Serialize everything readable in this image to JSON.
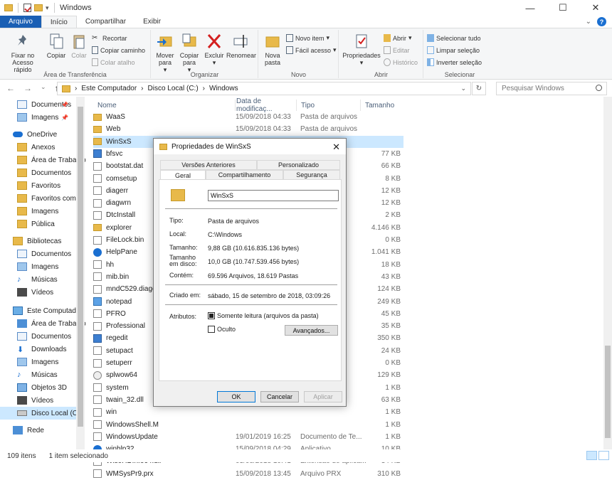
{
  "window": {
    "title": "Windows"
  },
  "tabs": {
    "file": "Arquivo",
    "home": "Início",
    "share": "Compartilhar",
    "view": "Exibir"
  },
  "ribbon": {
    "pin": "Fixar no Acesso rápido",
    "copy": "Copiar",
    "paste": "Colar",
    "cut": "Recortar",
    "copy_path": "Copiar caminho",
    "paste_shortcut": "Colar atalho",
    "group_clipboard": "Área de Transferência",
    "move_to": "Mover para",
    "copy_to": "Copiar para",
    "delete": "Excluir",
    "rename": "Renomear",
    "group_organize": "Organizar",
    "new_folder": "Nova pasta",
    "new_item": "Novo item",
    "easy_access": "Fácil acesso",
    "group_new": "Novo",
    "properties": "Propriedades",
    "open": "Abrir",
    "edit": "Editar",
    "history": "Histórico",
    "group_open": "Abrir",
    "select_all": "Selecionar tudo",
    "clear_selection": "Limpar seleção",
    "invert_selection": "Inverter seleção",
    "group_select": "Selecionar"
  },
  "address": {
    "crumbs": [
      "Este Computador",
      "Disco Local (C:)",
      "Windows"
    ],
    "search_placeholder": "Pesquisar Windows"
  },
  "navpane": [
    {
      "label": "Documentos",
      "pinned": true
    },
    {
      "label": "Imagens",
      "pinned": true
    },
    {
      "label": "OneDrive"
    },
    {
      "label": "Anexos"
    },
    {
      "label": "Área de Trabalho"
    },
    {
      "label": "Documentos"
    },
    {
      "label": "Favoritos"
    },
    {
      "label": "Favoritos compa"
    },
    {
      "label": "Imagens"
    },
    {
      "label": "Pública"
    },
    {
      "label": "Bibliotecas"
    },
    {
      "label": "Documentos"
    },
    {
      "label": "Imagens"
    },
    {
      "label": "Músicas"
    },
    {
      "label": "Vídeos"
    },
    {
      "label": "Este Computador"
    },
    {
      "label": "Área de Trabalho"
    },
    {
      "label": "Documentos"
    },
    {
      "label": "Downloads"
    },
    {
      "label": "Imagens"
    },
    {
      "label": "Músicas"
    },
    {
      "label": "Objetos 3D"
    },
    {
      "label": "Vídeos"
    },
    {
      "label": "Disco Local (C:)"
    },
    {
      "label": "Rede"
    }
  ],
  "columns": {
    "name": "Nome",
    "date": "Data de modificaç...",
    "type": "Tipo",
    "size": "Tamanho"
  },
  "files": [
    {
      "name": "WaaS",
      "date": "15/09/2018 04:33",
      "type": "Pasta de arquivos",
      "size": "",
      "icon": "folder"
    },
    {
      "name": "Web",
      "date": "15/09/2018 04:33",
      "type": "Pasta de arquivos",
      "size": "",
      "icon": "folder"
    },
    {
      "name": "WinSxS",
      "date": "",
      "type": "",
      "size": "",
      "icon": "folder"
    },
    {
      "name": "bfsvc",
      "date": "",
      "type": "",
      "size": "77 KB",
      "icon": "app"
    },
    {
      "name": "bootstat.dat",
      "date": "",
      "type": "",
      "size": "66 KB",
      "icon": "file"
    },
    {
      "name": "comsetup",
      "date": "",
      "type": "",
      "size": "8 KB",
      "icon": "file"
    },
    {
      "name": "diagerr",
      "date": "",
      "type": "",
      "size": "12 KB",
      "icon": "file"
    },
    {
      "name": "diagwrn",
      "date": "",
      "type": "",
      "size": "12 KB",
      "icon": "file"
    },
    {
      "name": "DtcInstall",
      "date": "",
      "type": "",
      "size": "2 KB",
      "icon": "file"
    },
    {
      "name": "explorer",
      "date": "",
      "type": "",
      "size": "4.146 KB",
      "icon": "folder"
    },
    {
      "name": "FileLock.bin",
      "date": "",
      "type": "",
      "size": "0 KB",
      "icon": "file"
    },
    {
      "name": "HelpPane",
      "date": "",
      "type": "",
      "size": "1.041 KB",
      "icon": "help"
    },
    {
      "name": "hh",
      "date": "",
      "type": "",
      "size": "18 KB",
      "icon": "file"
    },
    {
      "name": "mib.bin",
      "date": "",
      "type": "",
      "size": "43 KB",
      "icon": "file"
    },
    {
      "name": "mndC529.diage",
      "date": "",
      "type": "",
      "size": "124 KB",
      "icon": "file"
    },
    {
      "name": "notepad",
      "date": "",
      "type": "",
      "size": "249 KB",
      "icon": "note"
    },
    {
      "name": "PFRO",
      "date": "",
      "type": "",
      "size": "45 KB",
      "icon": "file"
    },
    {
      "name": "Professional",
      "date": "",
      "type": "",
      "size": "35 KB",
      "icon": "file"
    },
    {
      "name": "regedit",
      "date": "",
      "type": "",
      "size": "350 KB",
      "icon": "app"
    },
    {
      "name": "setupact",
      "date": "",
      "type": "",
      "size": "24 KB",
      "icon": "file"
    },
    {
      "name": "setuperr",
      "date": "",
      "type": "",
      "size": "0 KB",
      "icon": "file"
    },
    {
      "name": "splwow64",
      "date": "",
      "type": "",
      "size": "129 KB",
      "icon": "gear"
    },
    {
      "name": "system",
      "date": "",
      "type": "",
      "size": "1 KB",
      "icon": "file"
    },
    {
      "name": "twain_32.dll",
      "date": "",
      "type": "",
      "size": "63 KB",
      "icon": "file"
    },
    {
      "name": "win",
      "date": "",
      "type": "",
      "size": "1 KB",
      "icon": "file"
    },
    {
      "name": "WindowsShell.M",
      "date": "",
      "type": "",
      "size": "1 KB",
      "icon": "file"
    },
    {
      "name": "WindowsUpdate",
      "date": "19/01/2019 16:25",
      "type": "Documento de Te...",
      "size": "1 KB",
      "icon": "file"
    },
    {
      "name": "winhlp32",
      "date": "15/09/2018 04:29",
      "type": "Aplicativo",
      "size": "10 KB",
      "icon": "help"
    },
    {
      "name": "WiseHDInfo64.dll",
      "date": "03/08/2018 10:41",
      "type": "Extensão de aplica...",
      "size": "34 KB",
      "icon": "file"
    },
    {
      "name": "WMSysPr9.prx",
      "date": "15/09/2018 13:45",
      "type": "Arquivo PRX",
      "size": "310 KB",
      "icon": "file"
    }
  ],
  "status": {
    "count": "109 itens",
    "selected": "1 item selecionado"
  },
  "dialog": {
    "title": "Propriedades de WinSxS",
    "tabs": {
      "prev": "Versões Anteriores",
      "custom": "Personalizado",
      "general": "Geral",
      "sharing": "Compartilhamento",
      "security": "Segurança"
    },
    "name": "WinSxS",
    "type_label": "Tipo:",
    "type_value": "Pasta de arquivos",
    "location_label": "Local:",
    "location_value": "C:\\Windows",
    "size_label": "Tamanho:",
    "size_value": "9,88 GB (10.616.835.136 bytes)",
    "disk_label": "Tamanho em disco:",
    "disk_value": "10,0 GB (10.747.539.456 bytes)",
    "contains_label": "Contém:",
    "contains_value": "69.596 Arquivos, 18.619 Pastas",
    "created_label": "Criado em:",
    "created_value": "sábado, 15 de setembro de 2018, 03:09:26",
    "attrs_label": "Atributos:",
    "readonly_label": "Somente leitura (arquivos da pasta)",
    "hidden_label": "Oculto",
    "advanced_button": "Avançados...",
    "ok": "OK",
    "cancel": "Cancelar",
    "apply": "Aplicar"
  }
}
